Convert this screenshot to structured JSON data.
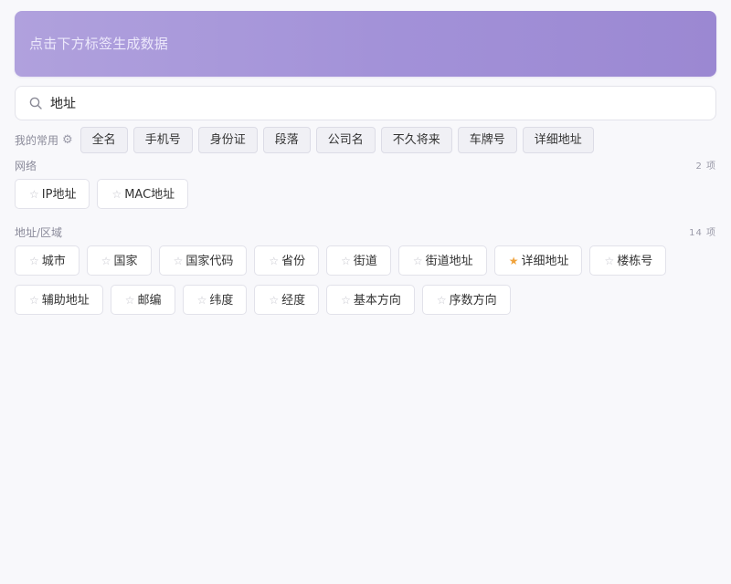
{
  "banner": {
    "text": "点击下方标签生成数据"
  },
  "search": {
    "value": "地址",
    "icon": "search-icon"
  },
  "favorites": {
    "label": "我的常用",
    "settings_icon": "gear-icon",
    "items": [
      "全名",
      "手机号",
      "身份证",
      "段落",
      "公司名",
      "不久将来",
      "车牌号",
      "详细地址"
    ]
  },
  "sections": [
    {
      "title": "网络",
      "count": "2 项",
      "items": [
        {
          "label": "IP地址",
          "starred": false
        },
        {
          "label": "MAC地址",
          "starred": false
        }
      ]
    },
    {
      "title": "地址/区域",
      "count": "14 项",
      "items": [
        {
          "label": "城市",
          "starred": false
        },
        {
          "label": "国家",
          "starred": false
        },
        {
          "label": "国家代码",
          "starred": false
        },
        {
          "label": "省份",
          "starred": false
        },
        {
          "label": "街道",
          "starred": false
        },
        {
          "label": "街道地址",
          "starred": false
        },
        {
          "label": "详细地址",
          "starred": true
        },
        {
          "label": "楼栋号",
          "starred": false
        },
        {
          "label": "辅助地址",
          "starred": false
        },
        {
          "label": "邮编",
          "starred": false
        },
        {
          "label": "纬度",
          "starred": false
        },
        {
          "label": "经度",
          "starred": false
        },
        {
          "label": "基本方向",
          "starred": false
        },
        {
          "label": "序数方向",
          "starred": false
        }
      ]
    }
  ],
  "colors": {
    "star_active": "#f0a23a",
    "star_inactive": "#c4c4cc",
    "banner_start": "#b0a1dd",
    "banner_end": "#9b88d2"
  }
}
